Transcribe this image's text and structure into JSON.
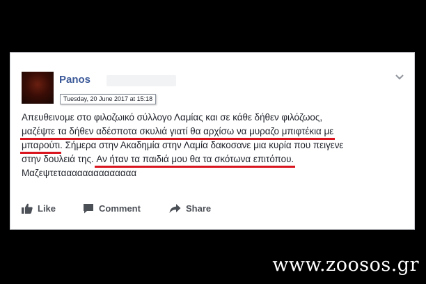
{
  "post": {
    "author_name": "Panos",
    "timestamp_tooltip": "Tuesday, 20 June 2017 at 15:18",
    "lines": [
      {
        "before": "Απευθεινομε στο φιλοζωικό σύλλογο Λαμίας και σε κάθε δήθεν φιλόζωος,",
        "highlight": "",
        "after": ""
      },
      {
        "before": "",
        "highlight": "μαζέψτε τα δήθεν αδέσποτα σκυλιά γιατί θα αρχίσω να μυραζο μπιφτέκια με",
        "after": ""
      },
      {
        "before": "",
        "highlight": "μπαρούτι",
        "after": ". Σήμερα στην Ακαδημία στην Λαμία δακοσανε μια κυρία που πειγενε"
      },
      {
        "before": "στην δουλειά της. ",
        "highlight": "Αν ήταν τα παιδιά μου θα τα σκότωνα επιτόπου.",
        "after": ""
      },
      {
        "before": "Μαζεψτεταααααααααααααα",
        "highlight": "",
        "after": ""
      }
    ]
  },
  "actions": {
    "like": "Like",
    "comment": "Comment",
    "share": "Share"
  },
  "watermark": "www.zoosos.gr",
  "colors": {
    "author": "#3b5998",
    "underline": "#d9141e",
    "action_text": "#4b4f56"
  }
}
